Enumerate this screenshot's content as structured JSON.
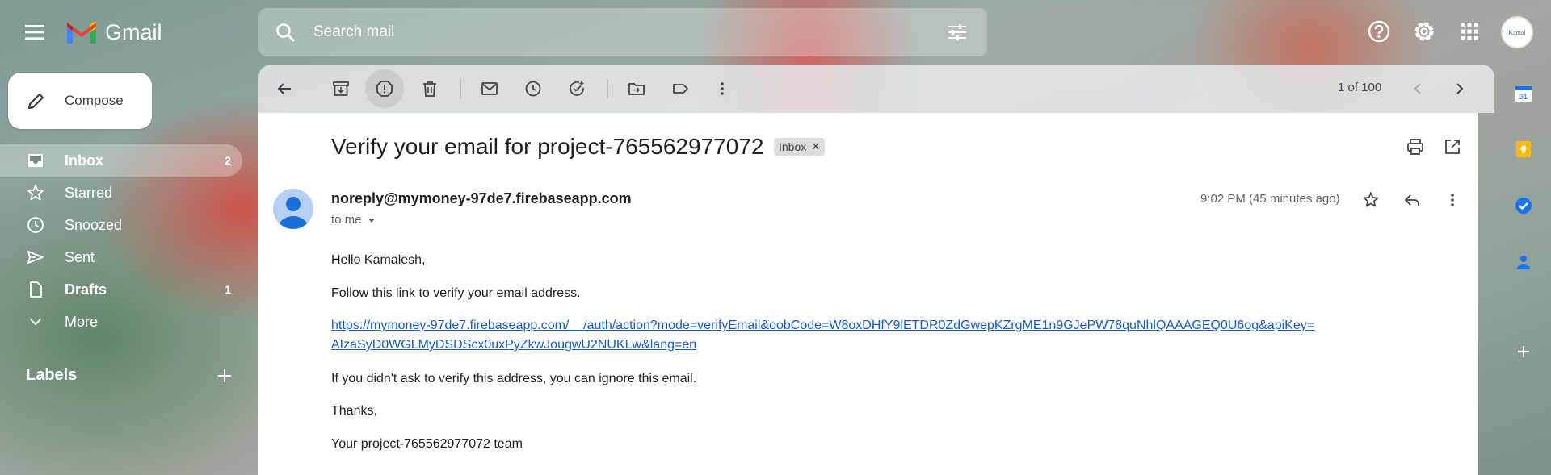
{
  "app": {
    "name": "Gmail"
  },
  "search": {
    "placeholder": "Search mail"
  },
  "user": {
    "avatar_text": "Kamal"
  },
  "compose": {
    "label": "Compose"
  },
  "nav": {
    "items": [
      {
        "label": "Inbox",
        "count": "2",
        "icon": "inbox-icon"
      },
      {
        "label": "Starred",
        "count": "",
        "icon": "star-icon"
      },
      {
        "label": "Snoozed",
        "count": "",
        "icon": "clock-icon"
      },
      {
        "label": "Sent",
        "count": "",
        "icon": "send-icon"
      },
      {
        "label": "Drafts",
        "count": "1",
        "icon": "draft-icon"
      },
      {
        "label": "More",
        "count": "",
        "icon": "chevron-down-icon"
      }
    ],
    "labels_title": "Labels"
  },
  "toolbar": {
    "pager": "1 of 100"
  },
  "email": {
    "subject": "Verify your email for project-765562977072",
    "chip": "Inbox",
    "sender": "noreply@mymoney-97de7.firebaseapp.com",
    "to": "to me",
    "time": "9:02 PM (45 minutes ago)",
    "greeting": "Hello Kamalesh,",
    "instruction": "Follow this link to verify your email address.",
    "link_line1": "https://mymoney-97de7.firebaseapp.com/__/auth/action?mode=verifyEmail&oobCode=W8oxDHfY9lETDR0ZdGwepKZrgME1n9GJePW78quNhlQAAAGEQ0U6og&apiKey=",
    "link_line2": "AIzaSyD0WGLMyDSDScx0uxPyZkwJougwU2NUKLw&lang=en",
    "ignore": "If you didn't ask to verify this address, you can ignore this email.",
    "thanks": "Thanks,",
    "signature": "Your project-765562977072 team"
  },
  "colors": {
    "link": "#1a5bc4",
    "accent_blue": "#1a73e8"
  }
}
